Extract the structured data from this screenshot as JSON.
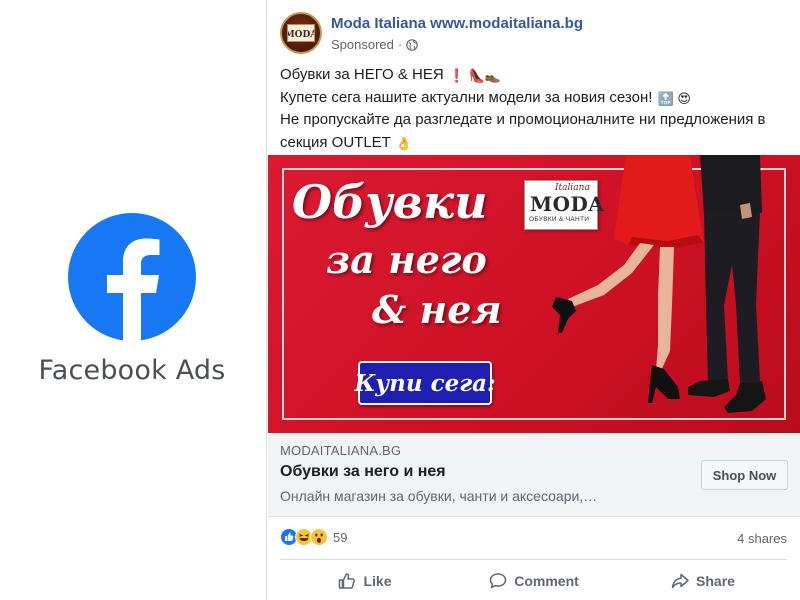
{
  "brand": {
    "caption": "Facebook Ads",
    "logo_color": "#1877f2"
  },
  "post": {
    "page_name": "Moda Italiana www.modaitaliana.bg",
    "sponsored": "Sponsored",
    "privacy_icon": "globe-icon",
    "text_lines": [
      "Обувки за НЕГО & НЕЯ",
      "Купете сега нашите актуални модели за новия сезон!",
      "Не пропускайте да разгледате и промоционалните ни предложения в секция OUTLET"
    ],
    "emojis": {
      "line1": "❗ 👠👞",
      "line2": "🔝 😍",
      "line3": "👌"
    },
    "avatar_label": "MODA"
  },
  "creative": {
    "headline_1": "Обувки",
    "headline_2": "за него",
    "headline_3": "& нея",
    "cta": "Купи сега:",
    "logo_script": "Italiana",
    "logo_main": "MODA",
    "logo_sub": "ОБУВКИ & ЧАНТИ",
    "background_color": "#d41a2e"
  },
  "link_preview": {
    "domain": "MODAITALIANA.BG",
    "title": "Обувки за него и нея",
    "description": "Онлайн магазин за обувки, чанти и аксесоари,…",
    "button": "Shop Now"
  },
  "engagement": {
    "reaction_icons": [
      "like-icon",
      "haha-icon",
      "wow-icon"
    ],
    "reaction_count": "59",
    "shares": "4 shares"
  },
  "actions": {
    "like": "Like",
    "comment": "Comment",
    "share": "Share"
  }
}
